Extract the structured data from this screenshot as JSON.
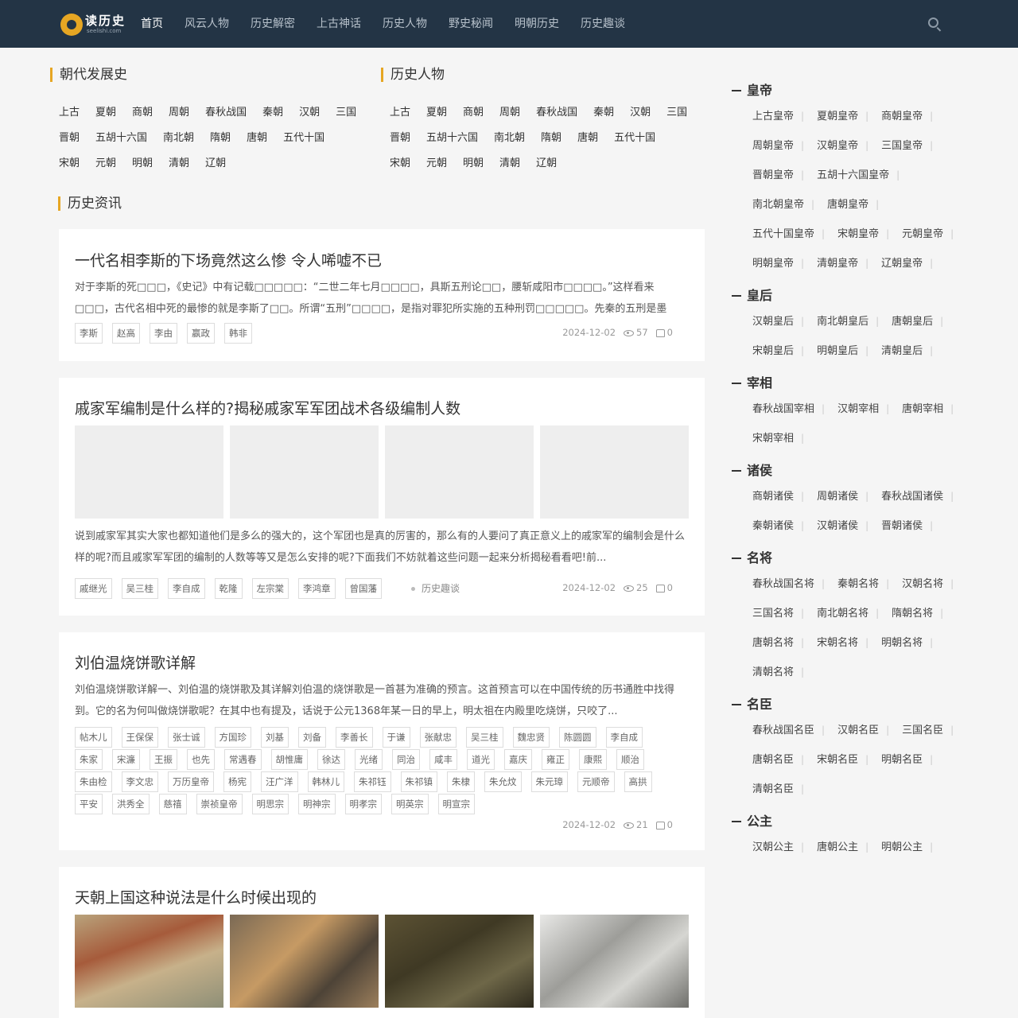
{
  "header": {
    "logo_text": "读历史",
    "logo_sub": "seelishi.com",
    "nav": [
      "首页",
      "风云人物",
      "历史解密",
      "上古神话",
      "历史人物",
      "野史秘闻",
      "明朝历史",
      "历史趣谈"
    ],
    "active": "首页"
  },
  "dynasty_section": {
    "title": "朝代发展史",
    "rows": [
      [
        "上古",
        "夏朝",
        "商朝",
        "周朝",
        "春秋战国",
        "秦朝",
        "汉朝",
        "三国"
      ],
      [
        "晋朝",
        "五胡十六国",
        "南北朝",
        "隋朝",
        "唐朝",
        "五代十国"
      ],
      [
        "宋朝",
        "元朝",
        "明朝",
        "清朝",
        "辽朝"
      ]
    ]
  },
  "people_section": {
    "title": "历史人物",
    "rows": [
      [
        "上古",
        "夏朝",
        "商朝",
        "周朝",
        "春秋战国",
        "秦朝",
        "汉朝",
        "三国"
      ],
      [
        "晋朝",
        "五胡十六国",
        "南北朝",
        "隋朝",
        "唐朝",
        "五代十国"
      ],
      [
        "宋朝",
        "元朝",
        "明朝",
        "清朝",
        "辽朝"
      ]
    ]
  },
  "news_title": "历史资讯",
  "articles": [
    {
      "title": "一代名相李斯的下场竟然这么惨 令人唏嘘不已",
      "excerpt": "对于李斯的死□□□，《史记》中有记载□□□□□：“二世二年七月□□□□，具斯五刑论□□，腰斩咸阳市□□□□。”这样看来□□□，古代名相中死的最惨的就是李斯了□□。所谓“五刑”□□□□，是指对罪犯所实施的五种刑罚□□□□□。先秦的五刑是墨□□□□□、...",
      "tags": [
        "李斯",
        "赵高",
        "李由",
        "嬴政",
        "韩非"
      ],
      "date": "2024-12-02",
      "views": "57",
      "likes": "0"
    },
    {
      "title": "戚家军编制是什么样的?揭秘戚家军军团战术各级编制人数",
      "excerpt": "说到戚家军其实大家也都知道他们是多么的强大的，这个军团也是真的厉害的，那么有的人要问了真正意义上的戚家军的编制会是什么样的呢?而且戚家军军团的编制的人数等等又是怎么安排的呢?下面我们不妨就着这些问题一起来分析揭秘看看吧!前...",
      "tags": [
        "戚继光",
        "吴三桂",
        "李自成",
        "乾隆",
        "左宗棠",
        "李鸿章",
        "曾国藩"
      ],
      "category": "历史趣谈",
      "date": "2024-12-02",
      "views": "25",
      "likes": "0"
    },
    {
      "title": "刘伯温烧饼歌详解",
      "excerpt": "刘伯温烧饼歌详解一、刘伯温的烧饼歌及其详解刘伯温的烧饼歌是一首甚为准确的预言。这首预言可以在中国传统的历书通胜中找得到。它的名为何叫做烧饼歌呢？在其中也有提及，话说于公元1368年某一日的早上，明太祖在内殿里吃烧饼，只咬了...",
      "tags": [
        "帖木儿",
        "王保保",
        "张士诚",
        "方国珍",
        "刘基",
        "刘备",
        "李善长",
        "于谦",
        "张献忠",
        "吴三桂",
        "魏忠贤",
        "陈圆圆",
        "李自成",
        "朱家",
        "宋濂",
        "王振",
        "也先",
        "常遇春",
        "胡惟庸",
        "徐达",
        "光绪",
        "同治",
        "咸丰",
        "道光",
        "嘉庆",
        "雍正",
        "康熙",
        "顺治",
        "朱由检",
        "李文忠",
        "万历皇帝",
        "杨宪",
        "汪广洋",
        "韩林儿",
        "朱祁钰",
        "朱祁镇",
        "朱棣",
        "朱允炆",
        "朱元璋",
        "元顺帝",
        "高拱",
        "平安",
        "洪秀全",
        "慈禧",
        "崇祯皇帝",
        "明思宗",
        "明神宗",
        "明孝宗",
        "明英宗",
        "明宣宗"
      ],
      "date": "2024-12-02",
      "views": "21",
      "likes": "0"
    },
    {
      "title": "天朝上国这种说法是什么时候出现的"
    }
  ],
  "sidebar": [
    {
      "title": "皇帝",
      "links": [
        "上古皇帝",
        "夏朝皇帝",
        "商朝皇帝",
        "周朝皇帝",
        "汉朝皇帝",
        "三国皇帝",
        "晋朝皇帝",
        "五胡十六国皇帝",
        "南北朝皇帝",
        "唐朝皇帝",
        "五代十国皇帝",
        "宋朝皇帝",
        "元朝皇帝",
        "明朝皇帝",
        "清朝皇帝",
        "辽朝皇帝"
      ]
    },
    {
      "title": "皇后",
      "links": [
        "汉朝皇后",
        "南北朝皇后",
        "唐朝皇后",
        "宋朝皇后",
        "明朝皇后",
        "清朝皇后"
      ]
    },
    {
      "title": "宰相",
      "links": [
        "春秋战国宰相",
        "汉朝宰相",
        "唐朝宰相",
        "宋朝宰相"
      ]
    },
    {
      "title": "诸侯",
      "links": [
        "商朝诸侯",
        "周朝诸侯",
        "春秋战国诸侯",
        "秦朝诸侯",
        "汉朝诸侯",
        "晋朝诸侯"
      ]
    },
    {
      "title": "名将",
      "links": [
        "春秋战国名将",
        "秦朝名将",
        "汉朝名将",
        "三国名将",
        "南北朝名将",
        "隋朝名将",
        "唐朝名将",
        "宋朝名将",
        "明朝名将",
        "清朝名将"
      ]
    },
    {
      "title": "名臣",
      "links": [
        "春秋战国名臣",
        "汉朝名臣",
        "三国名臣",
        "唐朝名臣",
        "宋朝名臣",
        "明朝名臣",
        "清朝名臣"
      ]
    },
    {
      "title": "公主",
      "links": [
        "汉朝公主",
        "唐朝公主",
        "明朝公主"
      ]
    }
  ]
}
